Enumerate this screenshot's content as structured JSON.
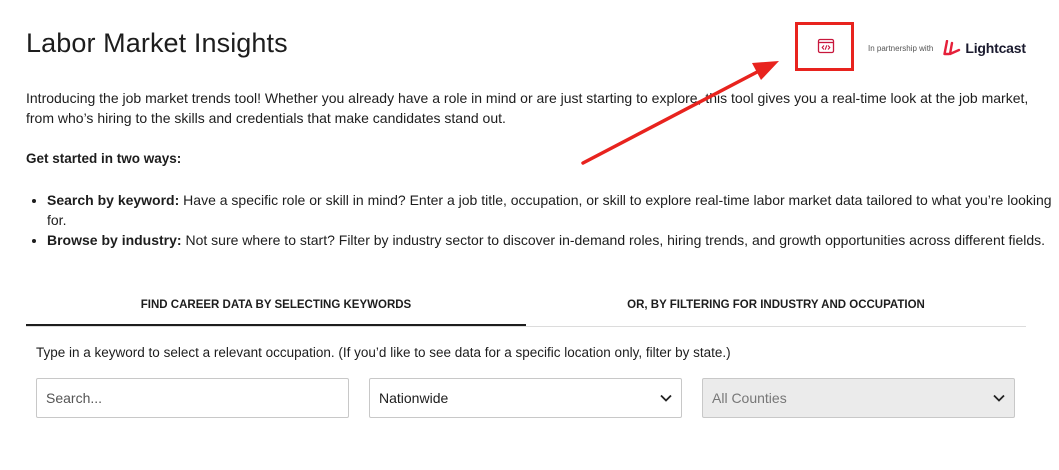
{
  "header": {
    "title": "Labor Market Insights",
    "partner_text": "In partnership with",
    "partner_logo_name": "Lightcast",
    "embed_icon": "code-window-icon"
  },
  "intro": "Introducing the job market trends tool! Whether you already have a role in mind or are just starting to explore, this tool gives you a real-time look at the job market, from who’s hiring to the skills and credentials that make candidates stand out.",
  "get_started": {
    "heading": "Get started in two ways:",
    "items": [
      {
        "label": "Search by keyword:",
        "text": "Have a specific role or skill in mind? Enter a job title, occupation, or skill to explore real-time labor market data tailored to what you’re looking for."
      },
      {
        "label": "Browse by industry:",
        "text": "Not sure where to start? Filter by industry sector to discover in-demand roles, hiring trends, and growth opportunities across different fields."
      }
    ]
  },
  "tabs": [
    {
      "label": "FIND CAREER DATA BY SELECTING KEYWORDS",
      "active": true
    },
    {
      "label": "OR, BY FILTERING FOR INDUSTRY AND OCCUPATION",
      "active": false
    }
  ],
  "search": {
    "instruction": "Type in a keyword to select a relevant occupation. (If you’d like to see data for a specific location only, filter by state.)",
    "placeholder": "Search...",
    "state_value": "Nationwide",
    "county_value": "All Counties"
  },
  "colors": {
    "annotation_red": "#e8231e",
    "embed_icon_color": "#c8173c",
    "lightcast_brand": "#e5203a",
    "disabled_field_bg": "#ebebeb"
  }
}
